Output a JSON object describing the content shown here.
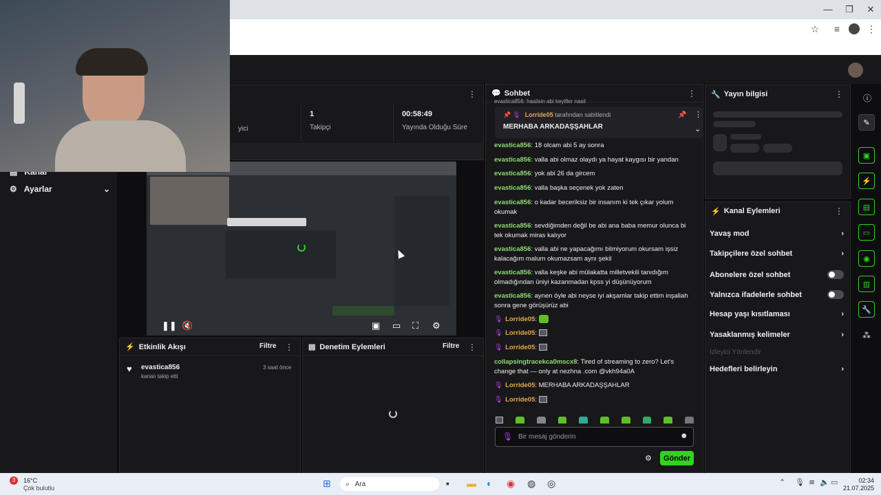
{
  "window": {
    "minimize": "—",
    "restore": "❐",
    "close": "✕"
  },
  "toolbar": {
    "star": "☆",
    "menu": "⋮",
    "queue": "≡"
  },
  "stats": [
    {
      "value": "",
      "label": "yici"
    },
    {
      "value": "1",
      "label": "Takipçi"
    },
    {
      "value": "00:58:49",
      "label": "Yayında Olduğu Süre"
    }
  ],
  "nav": {
    "channel_label": "Kanal",
    "settings_label": "Ayarlar"
  },
  "activity": {
    "title": "Etkinlik Akışı",
    "filter": "Filtre",
    "user": "evastica856",
    "action": "kanalı takip etti",
    "time": "3 saat önce"
  },
  "moderation": {
    "title": "Denetim Eylemleri",
    "filter": "Filtre"
  },
  "chat": {
    "title": "Sohbet",
    "top_partial": "evastica856: hasilsin abi keyifler nasil",
    "pinned": {
      "by": "Lorride05",
      "by_suffix": "tarafından sabitlendi",
      "text": "MERHABA ARKADAŞŞAHLAR"
    },
    "messages": [
      {
        "user": "evastica856",
        "text": "18 olcam abi 5 ay sonra"
      },
      {
        "user": "evastica856",
        "text": "valla abi olmaz olaydı ya hayat kaygısı bir yandan"
      },
      {
        "user": "evastica856",
        "text": "yok abi 26 da gircem"
      },
      {
        "user": "evastica856",
        "text": "valla başka seçenek yok zaten"
      },
      {
        "user": "evastica856",
        "text": "o kadar beceriksiz bir insanım ki tek çıkar yolum okumak"
      },
      {
        "user": "evastica856",
        "text": "sevdiğimden değil be abi ana baba memur olunca bi tek okumak miras kalıyor"
      },
      {
        "user": "evastica856",
        "text": "valla abi ne yapacağımı bilmiyorum okursam işsiz kalacağım malum okumazsam aynı şekil"
      },
      {
        "user": "evastica856",
        "text": "valla keşke abi mülakatta milletvekili tanıdığım olmadığından üniyi kazanmadan kpss yi düşünüyorum"
      },
      {
        "user": "evastica856",
        "text": "aynen öyle abi neyse iyi akşamlar takip ettim inşallah sonra gene görüşürüz abi"
      },
      {
        "user": "Lorride05",
        "text": ""
      },
      {
        "user": "Lorride05",
        "text": ""
      },
      {
        "user": "Lorride05",
        "text": ""
      },
      {
        "user": "collapsingtracekca0mscx8",
        "text": "Tired of streaming to zero? Let's change that — only at nezhna .com @vkh94a0A"
      },
      {
        "user": "Lorride05",
        "text": "MERHABA ARKADAŞŞAHLAR"
      },
      {
        "user": "Lorride05",
        "text": ""
      }
    ],
    "input_placeholder": "Bir mesaj gönderin",
    "send": "Gönder"
  },
  "stream_info": {
    "title": "Yayın bilgisi"
  },
  "channel_actions": {
    "title": "Kanal Eylemleri",
    "items": [
      {
        "label": "Yavaş mod",
        "kind": "arrow"
      },
      {
        "label": "Takipçilere özel sohbet",
        "kind": "arrow"
      },
      {
        "label": "Abonelere özel sohbet",
        "kind": "toggle"
      },
      {
        "label": "Yalnızca ifadelerle sohbet",
        "kind": "toggle"
      },
      {
        "label": "Hesap yaşı kısıtlaması",
        "kind": "arrow"
      },
      {
        "label": "Yasaklanmış kelimeler",
        "kind": "arrow"
      },
      {
        "label": "İzleyici Yönlendir",
        "kind": "disabled"
      },
      {
        "label": "Hedefleri belirleyin",
        "kind": "arrow"
      }
    ]
  },
  "taskbar": {
    "temp": "16°C",
    "weather": "Çok bulutlu",
    "badge": "3",
    "search": "Ara",
    "time": "02:34",
    "date": "21.07.2025"
  },
  "colors": {
    "accent": "#32d31f",
    "username": "#8fdc6f",
    "mod_user": "#e6a94d",
    "mic": "#c03cf0"
  }
}
